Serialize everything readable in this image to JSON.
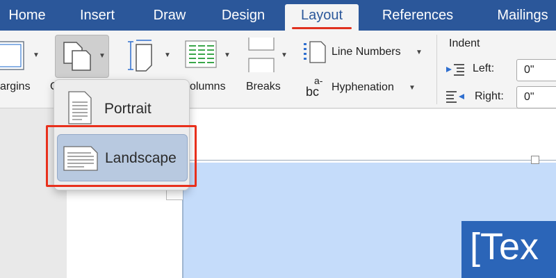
{
  "tabs": [
    {
      "label": "Home"
    },
    {
      "label": "Insert"
    },
    {
      "label": "Draw"
    },
    {
      "label": "Design"
    },
    {
      "label": "Layout"
    },
    {
      "label": "References"
    },
    {
      "label": "Mailings"
    }
  ],
  "ribbon": {
    "margins_label": "argins",
    "orientation_label": "O",
    "columns_label": "olumns",
    "breaks_label": "Breaks",
    "line_numbers_label": "Line Numbers",
    "hyphenation_label": "Hyphenation",
    "hyphenation_glyph_top": "a-",
    "hyphenation_glyph_bottom": "bc",
    "indent": {
      "title": "Indent",
      "left_label": "Left:",
      "left_value": "0\"",
      "right_label": "Right:",
      "right_value": "0\""
    }
  },
  "orientation_menu": {
    "items": [
      {
        "label": "Portrait"
      },
      {
        "label": "Landscape"
      }
    ],
    "selected": "Landscape"
  },
  "document": {
    "textbox_text": "[Tex"
  },
  "colors": {
    "tab_bar": "#2b579a",
    "active_tab_underline": "#e0301e",
    "highlight": "#e8301c",
    "selection": "#c5dcfa",
    "textbox": "#2b65b8"
  }
}
